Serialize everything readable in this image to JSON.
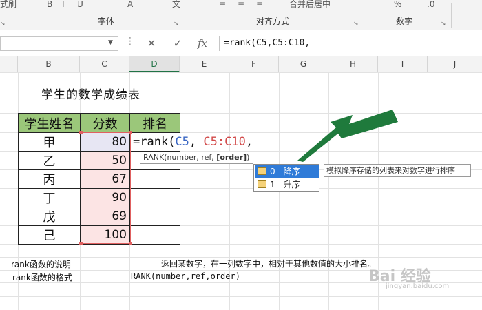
{
  "ribbon": {
    "left_cut": "式刷",
    "font_group": "字体",
    "align_group": "对齐方式",
    "number_group": "数字",
    "merge_label": "合并后居中",
    "percent": "%"
  },
  "formula_bar": {
    "cancel_icon": "✕",
    "enter_icon": "✓",
    "fx_label": "fx",
    "formula": "=rank(C5,C5:C10,"
  },
  "columns": [
    "B",
    "C",
    "D",
    "E",
    "F",
    "G",
    "H",
    "I",
    "J"
  ],
  "sheet": {
    "title": "学生的数学成绩表",
    "headers": [
      "学生姓名",
      "分数",
      "排名"
    ],
    "rows": [
      {
        "name": "甲",
        "score": "80"
      },
      {
        "name": "乙",
        "score": "50"
      },
      {
        "name": "丙",
        "score": "67"
      },
      {
        "name": "丁",
        "score": "90"
      },
      {
        "name": "戊",
        "score": "69"
      },
      {
        "name": "己",
        "score": "100"
      }
    ],
    "editing": {
      "prefix": "=rank(",
      "ref1": "C5",
      "sep": ", ",
      "ref2": "C5:C10",
      "suffix": ","
    }
  },
  "tooltip": {
    "prefix": "RANK(number, ref, ",
    "bold": "[order]",
    "suffix": ")"
  },
  "autocomplete": {
    "items": [
      "0 - 降序",
      "1 - 升序"
    ],
    "selected_description": "模拟降序存储的列表来对数字进行排序"
  },
  "notes": {
    "label1": "rank函数的说明",
    "desc1": "返回某数字，在一列数字中，相对于其他数值的大小排名。",
    "label2": "rank函数的格式",
    "desc2": "RANK(number,ref,order)"
  },
  "watermark": {
    "text": "Bai 经验",
    "sub": "jingyan.baidu.com"
  },
  "colors": {
    "accent": "#217346",
    "header_fill": "#9bc77a",
    "arrow": "#1f7a3c",
    "selection": "#2f7bd8"
  }
}
